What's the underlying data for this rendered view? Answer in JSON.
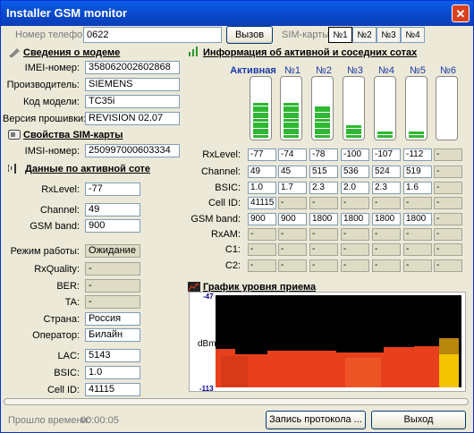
{
  "window": {
    "title": "Installer GSM monitor",
    "close": "✕"
  },
  "toolbar": {
    "phone_label": "Номер телефона",
    "phone_value": "0622",
    "call_button": "Вызов",
    "sim_label": "SIM-карты",
    "tabs": [
      "№1",
      "№2",
      "№3",
      "№4"
    ]
  },
  "modem": {
    "title": "Сведения о модеме",
    "rows": [
      {
        "label": "IMEI-номер:",
        "value": "358062002602868"
      },
      {
        "label": "Производитель:",
        "value": "SIEMENS"
      },
      {
        "label": "Код модели:",
        "value": "TC35i"
      },
      {
        "label": "Версия прошивки:",
        "value": "REVISION 02.07"
      }
    ]
  },
  "sim": {
    "title": "Свойства SIM-карты",
    "rows": [
      {
        "label": "IMSI-номер:",
        "value": "250997000603334"
      }
    ]
  },
  "active_cell": {
    "title": "Данные по активной соте",
    "rows": [
      {
        "label": "RxLevel:",
        "value": "-77"
      },
      {
        "label": "Channel:",
        "value": "49"
      },
      {
        "label": "GSM band:",
        "value": "900"
      },
      {
        "label": "Режим работы:",
        "value": "Ожидание"
      },
      {
        "label": "RxQuality:",
        "value": "-"
      },
      {
        "label": "BER:",
        "value": "-"
      },
      {
        "label": "TA:",
        "value": "-"
      },
      {
        "label": "Страна:",
        "value": "Россия"
      },
      {
        "label": "Оператор:",
        "value": "Билайн"
      },
      {
        "label": "LAC:",
        "value": "5143"
      },
      {
        "label": "BSIC:",
        "value": "1.0"
      },
      {
        "label": "Cell ID:",
        "value": "41115"
      }
    ]
  },
  "cells_info": {
    "title": "Информация об активной и соседних сотах",
    "columns": [
      "Активная",
      "№1",
      "№2",
      "№3",
      "№4",
      "№5",
      "№6"
    ],
    "signal_levels": [
      0.55,
      0.55,
      0.5,
      0.2,
      0.1,
      0.1,
      0
    ],
    "row_labels": [
      "RxLevel:",
      "Channel:",
      "BSIC:",
      "Cell ID:",
      "GSM band:",
      "RxAM:",
      "C1:",
      "C2:"
    ],
    "rows": [
      [
        "-77",
        "-74",
        "-78",
        "-100",
        "-107",
        "-112",
        "-"
      ],
      [
        "49",
        "45",
        "515",
        "536",
        "524",
        "519",
        "-"
      ],
      [
        "1.0",
        "1.7",
        "2.3",
        "2.0",
        "2.3",
        "1.6",
        "-"
      ],
      [
        "41115",
        "-",
        "-",
        "-",
        "-",
        "-",
        "-"
      ],
      [
        "900",
        "900",
        "1800",
        "1800",
        "1800",
        "1800",
        "-"
      ],
      [
        "-",
        "-",
        "-",
        "-",
        "-",
        "-",
        "-"
      ],
      [
        "-",
        "-",
        "-",
        "-",
        "-",
        "-",
        "-"
      ],
      [
        "-",
        "-",
        "-",
        "-",
        "-",
        "-",
        "-"
      ]
    ]
  },
  "chart": {
    "title": "График уровня приема",
    "ylabel": "dBm",
    "ymax_label": "-47",
    "ymin_label": "-113"
  },
  "colors": {
    "titlebar": "#0846c8",
    "signal_bar": "#2fb832",
    "chart_fill": "#e8401c",
    "chart_recent": "#f5c400"
  },
  "footer": {
    "elapsed_label": "Прошло времени:",
    "elapsed_value": "00:00:05",
    "log_button": "Запись протокола ...",
    "exit_button": "Выход"
  }
}
